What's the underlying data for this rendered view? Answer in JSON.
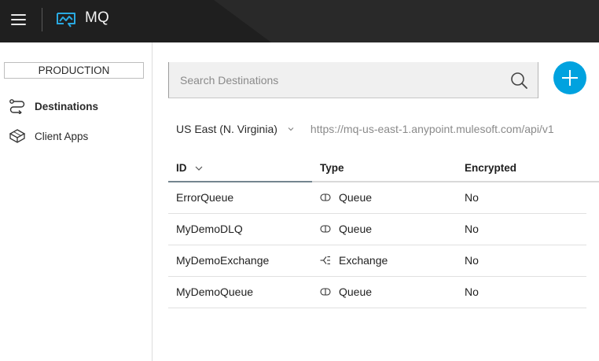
{
  "header": {
    "app_title": "MQ",
    "menu_icon": "hamburger-menu-icon",
    "logo_icon": "mq-logo-icon"
  },
  "sidebar": {
    "environment": "PRODUCTION",
    "items": [
      {
        "label": "Destinations",
        "icon": "destinations-icon",
        "active": true
      },
      {
        "label": "Client Apps",
        "icon": "client-apps-icon",
        "active": false
      }
    ]
  },
  "search": {
    "placeholder": "Search Destinations",
    "value": ""
  },
  "region": {
    "name": "US East (N. Virginia)",
    "url": "https://mq-us-east-1.anypoint.mulesoft.com/api/v1"
  },
  "table": {
    "columns": [
      "ID",
      "Type",
      "Encrypted"
    ],
    "rows": [
      {
        "id": "ErrorQueue",
        "type": "Queue",
        "type_icon": "queue-icon",
        "encrypted": "No"
      },
      {
        "id": "MyDemoDLQ",
        "type": "Queue",
        "type_icon": "queue-icon",
        "encrypted": "No"
      },
      {
        "id": "MyDemoExchange",
        "type": "Exchange",
        "type_icon": "exchange-icon",
        "encrypted": "No"
      },
      {
        "id": "MyDemoQueue",
        "type": "Queue",
        "type_icon": "queue-icon",
        "encrypted": "No"
      }
    ]
  },
  "colors": {
    "topbar": "#1f1f1f",
    "accent": "#00a2df",
    "logo": "#29a9e1"
  }
}
